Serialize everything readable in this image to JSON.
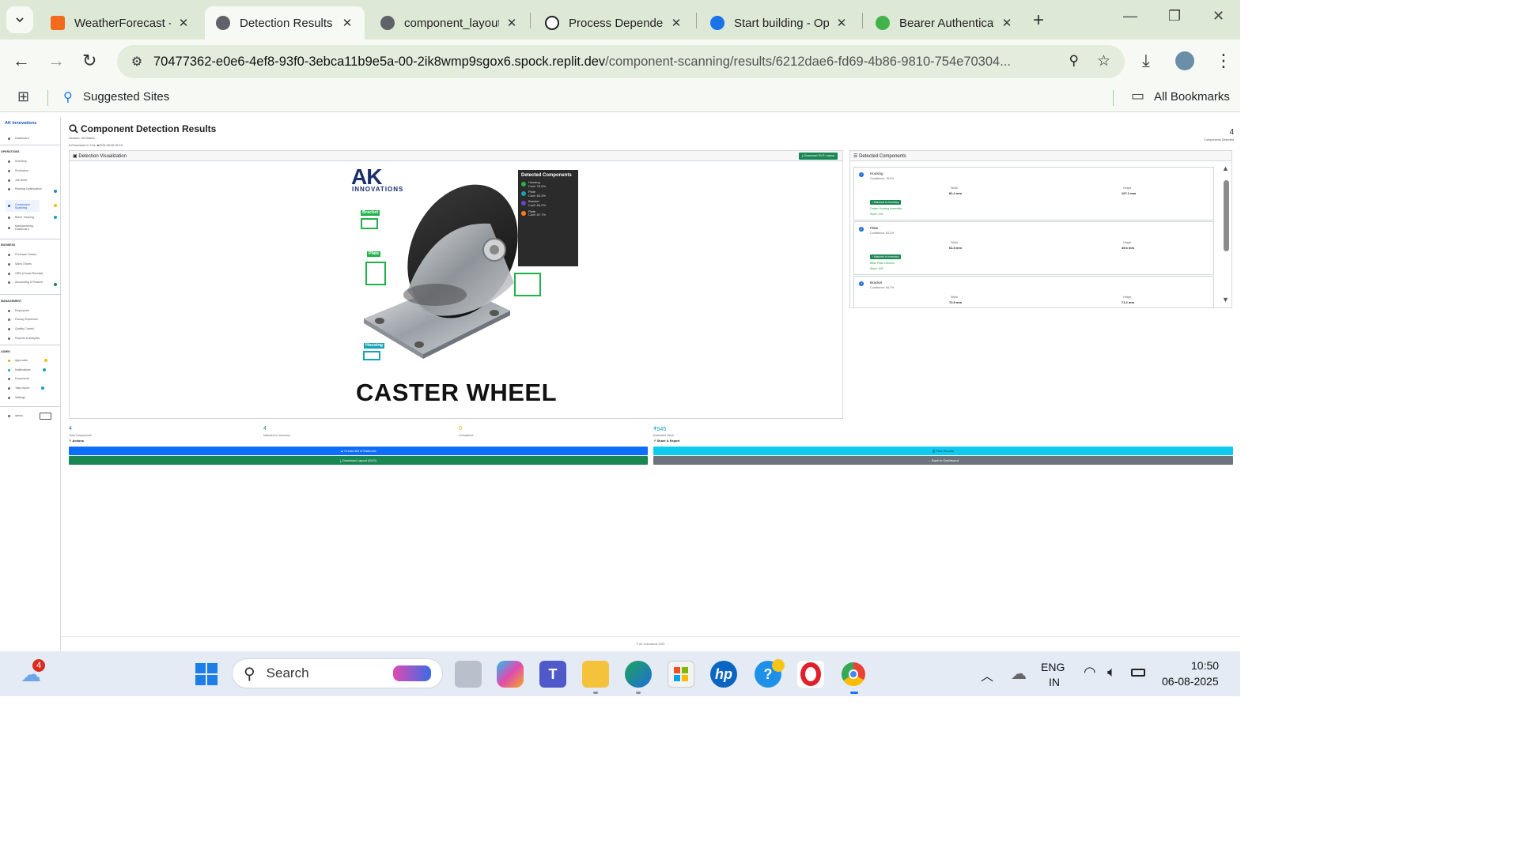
{
  "browser": {
    "tabs": [
      {
        "title": "WeatherForecast -",
        "color": "#f26b1d",
        "active": false
      },
      {
        "title": "Detection Results -",
        "color": "#5f6368",
        "active": true
      },
      {
        "title": "component_layout",
        "color": "#5f6368",
        "active": false
      },
      {
        "title": "Process Dependen",
        "color": "#202020",
        "active": false
      },
      {
        "title": "Start building - Op",
        "color": "#1a73e8",
        "active": false
      },
      {
        "title": "Bearer Authenticat",
        "color": "#41b34a",
        "active": false
      }
    ],
    "url_host": "70477362-e0e6-4ef8-93f0-3ebca11b9e5a-00-2ik8wmp9sgox6.spock.replit.dev",
    "url_path": "/component-scanning/results/6212dae6-fd69-4b86-9810-754e70304...",
    "bookmark_suggested": "Suggested Sites",
    "bookmark_all": "All Bookmarks"
  },
  "sidebar": {
    "brand": "AK Innovations",
    "dashboard": "Dashboard",
    "sections": {
      "operations": "OPERATIONS",
      "business": "BUSINESS",
      "management": "MANAGEMENT",
      "admin": "ADMIN"
    },
    "operations_items": [
      "Inventory",
      "Production",
      "Job Work",
      "Packing Optimization",
      "Component Scanning",
      "Batch Tracking",
      "Manufacturing Dashboard"
    ],
    "business_items": [
      "Purchase Orders",
      "Sales Orders",
      "GRN (Goods Receipt)",
      "Accounting & Finance"
    ],
    "management_items": [
      "Employees",
      "Factory Expenses",
      "Quality Control",
      "Reports & Analytics"
    ],
    "admin_items": [
      "Approvals",
      "Notifications",
      "Documents",
      "Tally Import",
      "Settings"
    ],
    "user": "admin"
  },
  "main": {
    "title": "Component Detection Results",
    "session": "Session: 6212dae6...",
    "processed": "Processed in 3.0s",
    "date": "2025-08-06 05:19",
    "components_detected_count": "4",
    "components_detected_label": "Components Detected",
    "viz_title": "Detection Visualization",
    "download_svg_small": "Download SVG Layout",
    "image": {
      "logo_big": "AK",
      "logo_small": "INNOVATIONS",
      "caption": "CASTER WHEEL",
      "legend_title": "Detected Components",
      "legend": [
        {
          "name": "Housing",
          "conf": "Conf: 78.5%",
          "color": "#22b14c"
        },
        {
          "name": "Plate",
          "conf": "Conf: 83.3%",
          "color": "#17a2b8"
        },
        {
          "name": "Bracket",
          "conf": "Conf: 84.2%",
          "color": "#6f42c1"
        },
        {
          "name": "Plate",
          "conf": "Conf: 87.7%",
          "color": "#fd7e14"
        }
      ],
      "tags": [
        "Bracket",
        "Plate",
        "Housing"
      ]
    },
    "detected_title": "Detected Components",
    "components": [
      {
        "num": "1",
        "name": "Housing",
        "confidence": "Confidence: 78.5%",
        "width_label": "Width",
        "width": "81.4 mm",
        "height_label": "Height",
        "height": "107.1 mm",
        "badge": "Matched to Inventory",
        "match": "Caster Housing Assembly",
        "stock": "Stock: 200"
      },
      {
        "num": "2",
        "name": "Plate",
        "confidence": "Confidence: 83.3%",
        "width_label": "Width",
        "width": "61.5 mm",
        "height_label": "Height",
        "height": "49.6 mm",
        "badge": "Matched to Inventory",
        "match": "Base Plate 150x100",
        "stock": "Stock: 300"
      },
      {
        "num": "3",
        "name": "Bracket",
        "confidence": "Confidence: 84.2%",
        "width_label": "Width",
        "width": "72.9 mm",
        "height_label": "Height",
        "height": "71.2 mm",
        "badge": "",
        "match": "",
        "stock": ""
      }
    ],
    "stats": [
      {
        "value": "4",
        "label": "Total Components",
        "color": "#1a6be0"
      },
      {
        "value": "4",
        "label": "Matched to Inventory",
        "color": "#198754"
      },
      {
        "value": "0",
        "label": "Unmatched",
        "color": "#e6a700"
      },
      {
        "value": "₹545",
        "label": "Estimated Value",
        "color": "#17a2b8"
      }
    ],
    "actions_label": "Actions",
    "share_label": "Share & Export",
    "btn_bom": "Create Bill of Materials",
    "btn_download": "Download Layout (SVG)",
    "btn_print": "Print Results",
    "btn_back": "Back to Dashboard",
    "footer": "© AK Innovations 2025"
  },
  "taskbar": {
    "weather_badge": "4",
    "search_placeholder": "Search",
    "lang1": "ENG",
    "lang2": "IN",
    "time": "10:50",
    "date": "06-08-2025"
  }
}
